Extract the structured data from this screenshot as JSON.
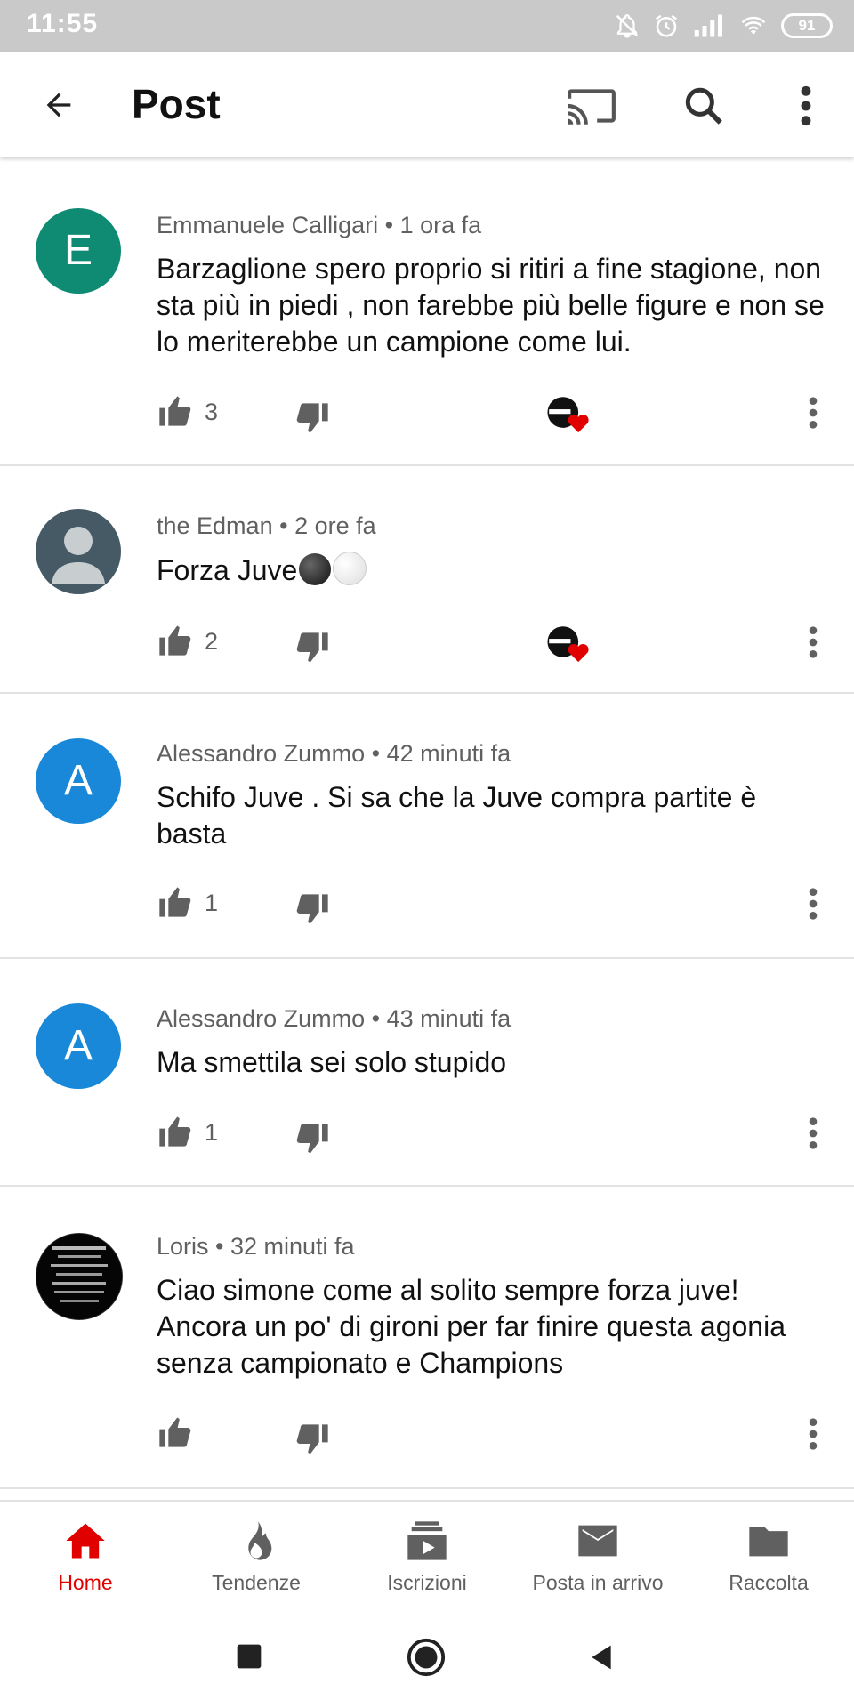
{
  "status_bar": {
    "time": "11:55",
    "battery": "91"
  },
  "app_bar": {
    "title": "Post",
    "icons": [
      "back-arrow-icon",
      "cast-icon",
      "search-icon",
      "more-vert-icon"
    ]
  },
  "comments": [
    {
      "avatar_letter": "E",
      "avatar_color": "#0f8a73",
      "author": "Emmanuele  Calligari",
      "time": "1 ora fa",
      "text": "Barzaglione spero proprio si ritiri a fine stagione, non sta più in piedi , non farebbe più belle figure e non se lo meriterebbe un campione come lui.",
      "likes": "3",
      "creator_heart": true
    },
    {
      "avatar_letter": "",
      "avatar_color": "#455a64",
      "author": "the Edman",
      "time": "2 ore fa",
      "text": "Forza Juve",
      "likes": "2",
      "creator_heart": true
    },
    {
      "avatar_letter": "A",
      "avatar_color": "#1a88d8",
      "author": "Alessandro Zummo",
      "time": "42 minuti fa",
      "text": "Schifo Juve . Si sa che la Juve compra partite è basta",
      "likes": "1",
      "creator_heart": false
    },
    {
      "avatar_letter": "A",
      "avatar_color": "#1a88d8",
      "author": "Alessandro Zummo",
      "time": "43 minuti fa",
      "text": "Ma smettila sei solo stupido",
      "likes": "1",
      "creator_heart": false
    },
    {
      "avatar_letter": "",
      "avatar_color": "#000000",
      "author": "Loris",
      "time": "32 minuti fa",
      "text": "Ciao simone come al solito sempre forza juve! Ancora un po' di gironi per far finire questa agonia senza campionato e Champions",
      "likes": "",
      "creator_heart": false
    }
  ],
  "bottom_nav": {
    "items": [
      {
        "label": "Home",
        "icon": "home-icon",
        "active": true
      },
      {
        "label": "Tendenze",
        "icon": "flame-icon",
        "active": false
      },
      {
        "label": "Iscrizioni",
        "icon": "subscriptions-icon",
        "active": false
      },
      {
        "label": "Posta in arrivo",
        "icon": "mail-icon",
        "active": false
      },
      {
        "label": "Raccolta",
        "icon": "folder-icon",
        "active": false
      }
    ]
  },
  "colors": {
    "accent": "#e00000",
    "icon_gray": "#606060"
  }
}
